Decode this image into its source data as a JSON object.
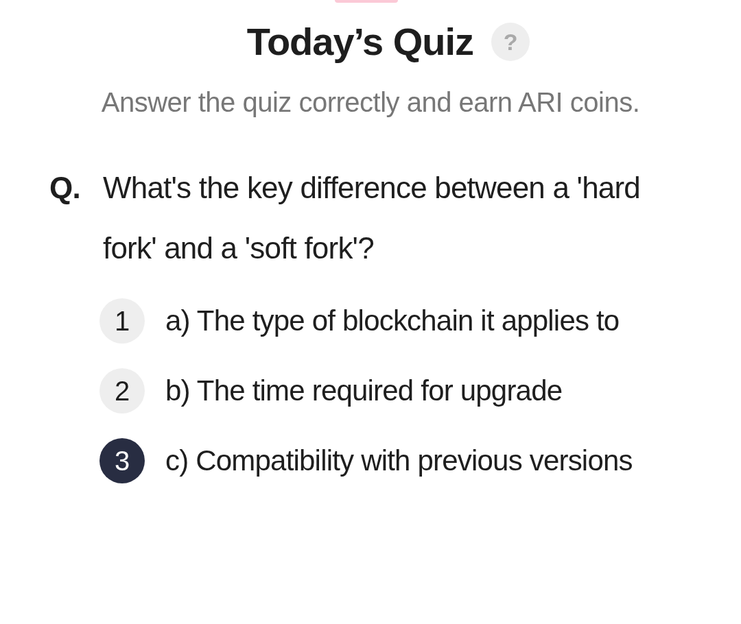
{
  "title": "Today’s Quiz",
  "help": "?",
  "subtitle": "Answer the quiz correctly and earn ARI coins.",
  "question": {
    "prefix": "Q.",
    "text": "What's the key difference between a 'hard fork' and a 'soft fork'?"
  },
  "options": [
    {
      "number": "1",
      "text": "a) The type of blockchain it applies to",
      "selected": false
    },
    {
      "number": "2",
      "text": "b) The time required for upgrade",
      "selected": false
    },
    {
      "number": "3",
      "text": "c) Compatibility with previous versions",
      "selected": true
    }
  ]
}
